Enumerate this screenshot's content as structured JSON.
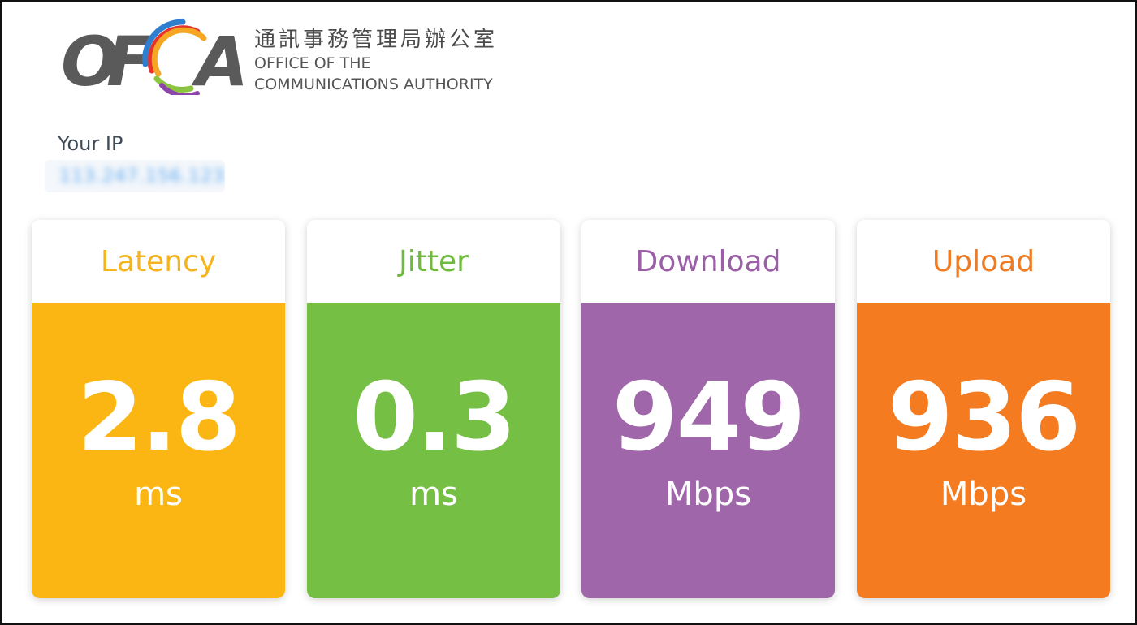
{
  "header": {
    "logo_letters": "OFCA",
    "org_name_chinese": "通訊事務管理局辦公室",
    "org_name_english_line1": "OFFICE OF THE",
    "org_name_english_line2": "COMMUNICATIONS AUTHORITY"
  },
  "ip": {
    "label": "Your IP",
    "value": "113.247.156.123"
  },
  "metrics": [
    {
      "title": "Latency",
      "value": "2.8",
      "unit": "ms",
      "accent": "#fbb614",
      "title_color": "#f5b31d"
    },
    {
      "title": "Jitter",
      "value": "0.3",
      "unit": "ms",
      "accent": "#74bf44",
      "title_color": "#6fbb3d"
    },
    {
      "title": "Download",
      "value": "949",
      "unit": "Mbps",
      "accent": "#a066aa",
      "title_color": "#9b5fa7"
    },
    {
      "title": "Upload",
      "value": "936",
      "unit": "Mbps",
      "accent": "#f47b20",
      "title_color": "#ef7b23"
    }
  ],
  "colors": {
    "background": "#ffffff",
    "text_dark": "#3e4a56",
    "logo_gray": "#555555"
  }
}
